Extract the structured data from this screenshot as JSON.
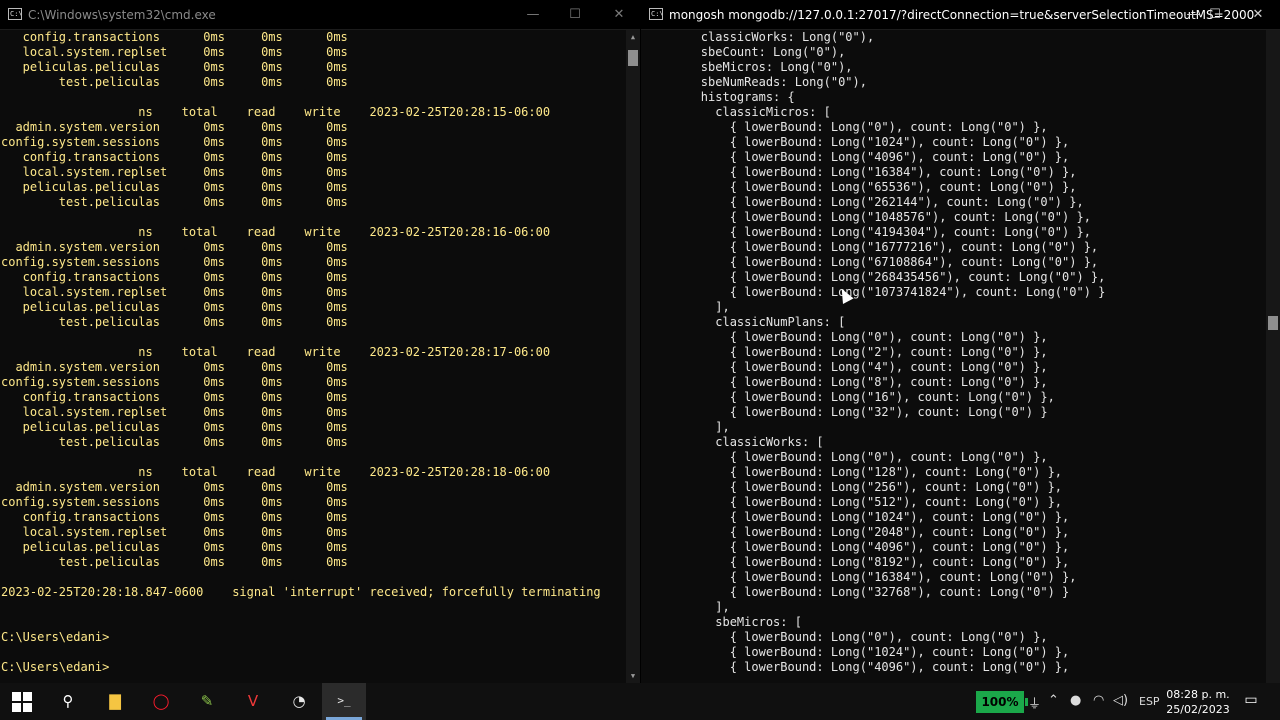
{
  "left_window": {
    "title": "C:\\Windows\\system32\\cmd.exe",
    "lines": [
      "   config.transactions      0ms     0ms      0ms",
      "   local.system.replset     0ms     0ms      0ms",
      "   peliculas.peliculas      0ms     0ms      0ms",
      "        test.peliculas      0ms     0ms      0ms",
      "",
      "                   ns    total    read    write    2023-02-25T20:28:15-06:00",
      "  admin.system.version      0ms     0ms      0ms",
      "config.system.sessions      0ms     0ms      0ms",
      "   config.transactions      0ms     0ms      0ms",
      "   local.system.replset     0ms     0ms      0ms",
      "   peliculas.peliculas      0ms     0ms      0ms",
      "        test.peliculas      0ms     0ms      0ms",
      "",
      "                   ns    total    read    write    2023-02-25T20:28:16-06:00",
      "  admin.system.version      0ms     0ms      0ms",
      "config.system.sessions      0ms     0ms      0ms",
      "   config.transactions      0ms     0ms      0ms",
      "   local.system.replset     0ms     0ms      0ms",
      "   peliculas.peliculas      0ms     0ms      0ms",
      "        test.peliculas      0ms     0ms      0ms",
      "",
      "                   ns    total    read    write    2023-02-25T20:28:17-06:00",
      "  admin.system.version      0ms     0ms      0ms",
      "config.system.sessions      0ms     0ms      0ms",
      "   config.transactions      0ms     0ms      0ms",
      "   local.system.replset     0ms     0ms      0ms",
      "   peliculas.peliculas      0ms     0ms      0ms",
      "        test.peliculas      0ms     0ms      0ms",
      "",
      "                   ns    total    read    write    2023-02-25T20:28:18-06:00",
      "  admin.system.version      0ms     0ms      0ms",
      "config.system.sessions      0ms     0ms      0ms",
      "   config.transactions      0ms     0ms      0ms",
      "   local.system.replset     0ms     0ms      0ms",
      "   peliculas.peliculas      0ms     0ms      0ms",
      "        test.peliculas      0ms     0ms      0ms",
      "",
      "2023-02-25T20:28:18.847-0600    signal 'interrupt' received; forcefully terminating",
      "",
      "",
      "C:\\Users\\edani>",
      "",
      "C:\\Users\\edani>"
    ]
  },
  "right_window": {
    "title": "mongosh mongodb://127.0.0.1:27017/?directConnection=true&serverSelectionTimeoutMS=2000",
    "lines": [
      "        classicWorks: Long(\"0\"),",
      "        sbeCount: Long(\"0\"),",
      "        sbeMicros: Long(\"0\"),",
      "        sbeNumReads: Long(\"0\"),",
      "        histograms: {",
      "          classicMicros: [",
      "            { lowerBound: Long(\"0\"), count: Long(\"0\") },",
      "            { lowerBound: Long(\"1024\"), count: Long(\"0\") },",
      "            { lowerBound: Long(\"4096\"), count: Long(\"0\") },",
      "            { lowerBound: Long(\"16384\"), count: Long(\"0\") },",
      "            { lowerBound: Long(\"65536\"), count: Long(\"0\") },",
      "            { lowerBound: Long(\"262144\"), count: Long(\"0\") },",
      "            { lowerBound: Long(\"1048576\"), count: Long(\"0\") },",
      "            { lowerBound: Long(\"4194304\"), count: Long(\"0\") },",
      "            { lowerBound: Long(\"16777216\"), count: Long(\"0\") },",
      "            { lowerBound: Long(\"67108864\"), count: Long(\"0\") },",
      "            { lowerBound: Long(\"268435456\"), count: Long(\"0\") },",
      "            { lowerBound: Long(\"1073741824\"), count: Long(\"0\") }",
      "          ],",
      "          classicNumPlans: [",
      "            { lowerBound: Long(\"0\"), count: Long(\"0\") },",
      "            { lowerBound: Long(\"2\"), count: Long(\"0\") },",
      "            { lowerBound: Long(\"4\"), count: Long(\"0\") },",
      "            { lowerBound: Long(\"8\"), count: Long(\"0\") },",
      "            { lowerBound: Long(\"16\"), count: Long(\"0\") },",
      "            { lowerBound: Long(\"32\"), count: Long(\"0\") }",
      "          ],",
      "          classicWorks: [",
      "            { lowerBound: Long(\"0\"), count: Long(\"0\") },",
      "            { lowerBound: Long(\"128\"), count: Long(\"0\") },",
      "            { lowerBound: Long(\"256\"), count: Long(\"0\") },",
      "            { lowerBound: Long(\"512\"), count: Long(\"0\") },",
      "            { lowerBound: Long(\"1024\"), count: Long(\"0\") },",
      "            { lowerBound: Long(\"2048\"), count: Long(\"0\") },",
      "            { lowerBound: Long(\"4096\"), count: Long(\"0\") },",
      "            { lowerBound: Long(\"8192\"), count: Long(\"0\") },",
      "            { lowerBound: Long(\"16384\"), count: Long(\"0\") },",
      "            { lowerBound: Long(\"32768\"), count: Long(\"0\") }",
      "          ],",
      "          sbeMicros: [",
      "            { lowerBound: Long(\"0\"), count: Long(\"0\") },",
      "            { lowerBound: Long(\"1024\"), count: Long(\"0\") },",
      "            { lowerBound: Long(\"4096\"), count: Long(\"0\") },"
    ]
  },
  "window_controls": {
    "minimize": "—",
    "maximize": "☐",
    "close": "✕"
  },
  "taskbar": {
    "icons": [
      "windows-start-icon",
      "search-icon",
      "file-explorer-icon",
      "opera-icon",
      "notepad-plus-plus-icon",
      "vivaldi-icon",
      "mongodb-compass-icon",
      "terminal-icon"
    ],
    "battery": "100%",
    "language": "ESP",
    "time": "08:28 p. m.",
    "date": "25/02/2023"
  },
  "colors": {
    "left_text": "#ffe98a",
    "right_text": "#e6e6e6",
    "terminal_bg": "#0c0c0c",
    "battery_green": "#1ba84a"
  }
}
